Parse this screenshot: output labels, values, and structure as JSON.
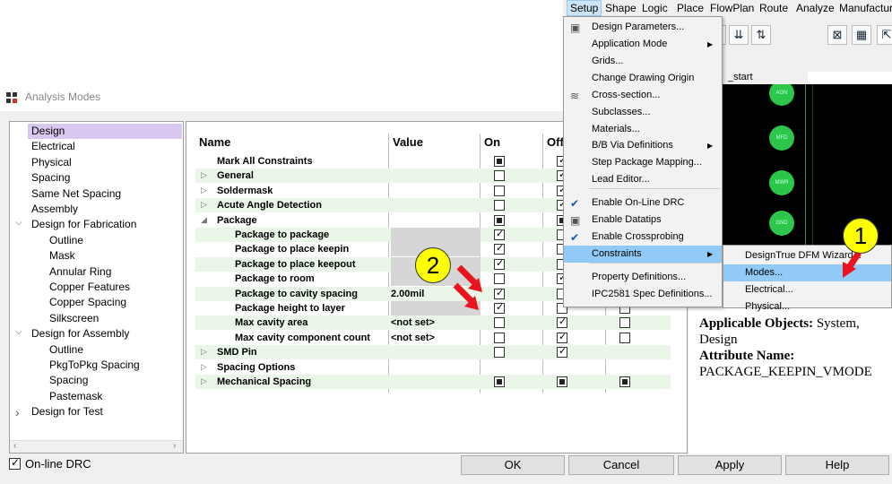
{
  "dialog": {
    "title": "Analysis Modes",
    "tree": [
      {
        "label": "Design",
        "level": 1,
        "selected": true
      },
      {
        "label": "Electrical",
        "level": 1
      },
      {
        "label": "Physical",
        "level": 1
      },
      {
        "label": "Spacing",
        "level": 1
      },
      {
        "label": "Same Net Spacing",
        "level": 1
      },
      {
        "label": "Assembly",
        "level": 1
      },
      {
        "label": "Design for Fabrication",
        "level": 1,
        "expander": "open"
      },
      {
        "label": "Outline",
        "level": 2
      },
      {
        "label": "Mask",
        "level": 2
      },
      {
        "label": "Annular Ring",
        "level": 2
      },
      {
        "label": "Copper Features",
        "level": 2
      },
      {
        "label": "Copper Spacing",
        "level": 2
      },
      {
        "label": "Silkscreen",
        "level": 2
      },
      {
        "label": "Design for Assembly",
        "level": 1,
        "expander": "open"
      },
      {
        "label": "Outline",
        "level": 2
      },
      {
        "label": "PkgToPkg Spacing",
        "level": 2
      },
      {
        "label": "Spacing",
        "level": 2
      },
      {
        "label": "Pastemask",
        "level": 2
      },
      {
        "label": "Design for Test",
        "level": 1,
        "expander": "closed"
      }
    ],
    "columns": {
      "name": "Name",
      "value": "Value",
      "on": "On",
      "off": "Off"
    },
    "rows": [
      {
        "name": "Mark All Constraints",
        "indent": 0,
        "expander": "",
        "value": "",
        "on": "filled",
        "off": "checked",
        "extra": ""
      },
      {
        "name": "General",
        "indent": 0,
        "expander": "closed",
        "value": "",
        "on": "empty",
        "off": "checked",
        "extra": ""
      },
      {
        "name": "Soldermask",
        "indent": 0,
        "expander": "closed",
        "value": "",
        "on": "empty",
        "off": "checked",
        "extra": ""
      },
      {
        "name": "Acute Angle Detection",
        "indent": 0,
        "expander": "closed",
        "value": "",
        "on": "empty",
        "off": "checked",
        "extra": ""
      },
      {
        "name": "Package",
        "indent": 0,
        "expander": "open",
        "value": "",
        "on": "filled",
        "off": "filled",
        "extra": ""
      },
      {
        "name": "Package to package",
        "indent": 1,
        "expander": "",
        "value": "",
        "value_gray": true,
        "on": "checked",
        "off": "empty",
        "extra": ""
      },
      {
        "name": "Package to place keepin",
        "indent": 1,
        "expander": "",
        "value": "",
        "value_gray": true,
        "on": "checked",
        "off": "empty",
        "extra": ""
      },
      {
        "name": "Package to place keepout",
        "indent": 1,
        "expander": "",
        "value": "",
        "value_gray": true,
        "on": "checked",
        "off": "empty",
        "extra": ""
      },
      {
        "name": "Package to room",
        "indent": 1,
        "expander": "",
        "value": "",
        "value_gray": true,
        "on": "empty",
        "off": "checked",
        "extra": ""
      },
      {
        "name": "Package to cavity spacing",
        "indent": 1,
        "expander": "",
        "value": "2.00mil",
        "on": "checked",
        "off": "empty",
        "extra": ""
      },
      {
        "name": "Package height to layer",
        "indent": 1,
        "expander": "",
        "value": "",
        "value_gray": true,
        "on": "checked",
        "off": "empty",
        "extra": "empty"
      },
      {
        "name": "Max cavity area",
        "indent": 1,
        "expander": "",
        "value": "<not set>",
        "on": "empty",
        "off": "checked",
        "extra": "empty"
      },
      {
        "name": "Max cavity component count",
        "indent": 1,
        "expander": "",
        "value": "<not set>",
        "on": "empty",
        "off": "checked",
        "extra": "empty"
      },
      {
        "name": "SMD Pin",
        "indent": 0,
        "expander": "closed",
        "value": "",
        "on": "empty",
        "off": "checked",
        "extra": ""
      },
      {
        "name": "Spacing Options",
        "indent": 0,
        "expander": "closed",
        "value": "",
        "on": "",
        "off": "",
        "extra": ""
      },
      {
        "name": "Mechanical Spacing",
        "indent": 0,
        "expander": "closed",
        "value": "",
        "on": "filled",
        "off": "filled",
        "extra": "filled"
      }
    ],
    "description": {
      "label1": "Applicable Objects:",
      "text1": "System, Design",
      "label2": "Attribute Name:",
      "text2": "PACKAGE_KEEPIN_VMODE"
    },
    "online_drc": {
      "label": "On-line DRC",
      "checked": true
    },
    "buttons": {
      "ok": "OK",
      "cancel": "Cancel",
      "apply": "Apply",
      "help": "Help"
    }
  },
  "menubar": [
    "Setup",
    "Shape",
    "Logic",
    "Place",
    "FlowPlan",
    "Route",
    "Analyze",
    "Manufacture"
  ],
  "setup_menu": [
    {
      "label": "Design Parameters...",
      "icon": "params-icon"
    },
    {
      "label": "Application Mode",
      "submenu": true
    },
    {
      "label": "Grids..."
    },
    {
      "label": "Change Drawing Origin"
    },
    {
      "label": "Cross-section...",
      "icon": "cross-section-icon"
    },
    {
      "label": "Subclasses..."
    },
    {
      "label": "Materials..."
    },
    {
      "label": "B/B Via Definitions",
      "submenu": true
    },
    {
      "label": "Step Package Mapping..."
    },
    {
      "label": "Lead Editor..."
    },
    {
      "label": "Enable On-Line DRC",
      "check": true
    },
    {
      "label": "Enable Datatips",
      "icon": "datatips-icon"
    },
    {
      "label": "Enable Crossprobing",
      "check": true
    },
    {
      "label": "Constraints",
      "submenu": true,
      "highlighted": true
    },
    {
      "label": "Property Definitions..."
    },
    {
      "label": "IPC2581 Spec Definitions..."
    }
  ],
  "constraints_submenu": [
    {
      "label": "DesignTrue DFM Wizard..."
    },
    {
      "label": "Modes...",
      "highlighted": true
    },
    {
      "label": "Electrical..."
    },
    {
      "label": "Physical..."
    }
  ],
  "canvas": {
    "tab": "_start",
    "pads": [
      "AGN",
      "MFD",
      "MWR",
      "GND"
    ]
  },
  "annotations": {
    "badge1": "1",
    "badge2": "2"
  },
  "colors": {
    "selection": "#d8c8f0",
    "menu_highlight": "#91c9f7",
    "stripe": "#eaf6e8",
    "badge": "#ffff00",
    "arrow": "#e8141e"
  }
}
